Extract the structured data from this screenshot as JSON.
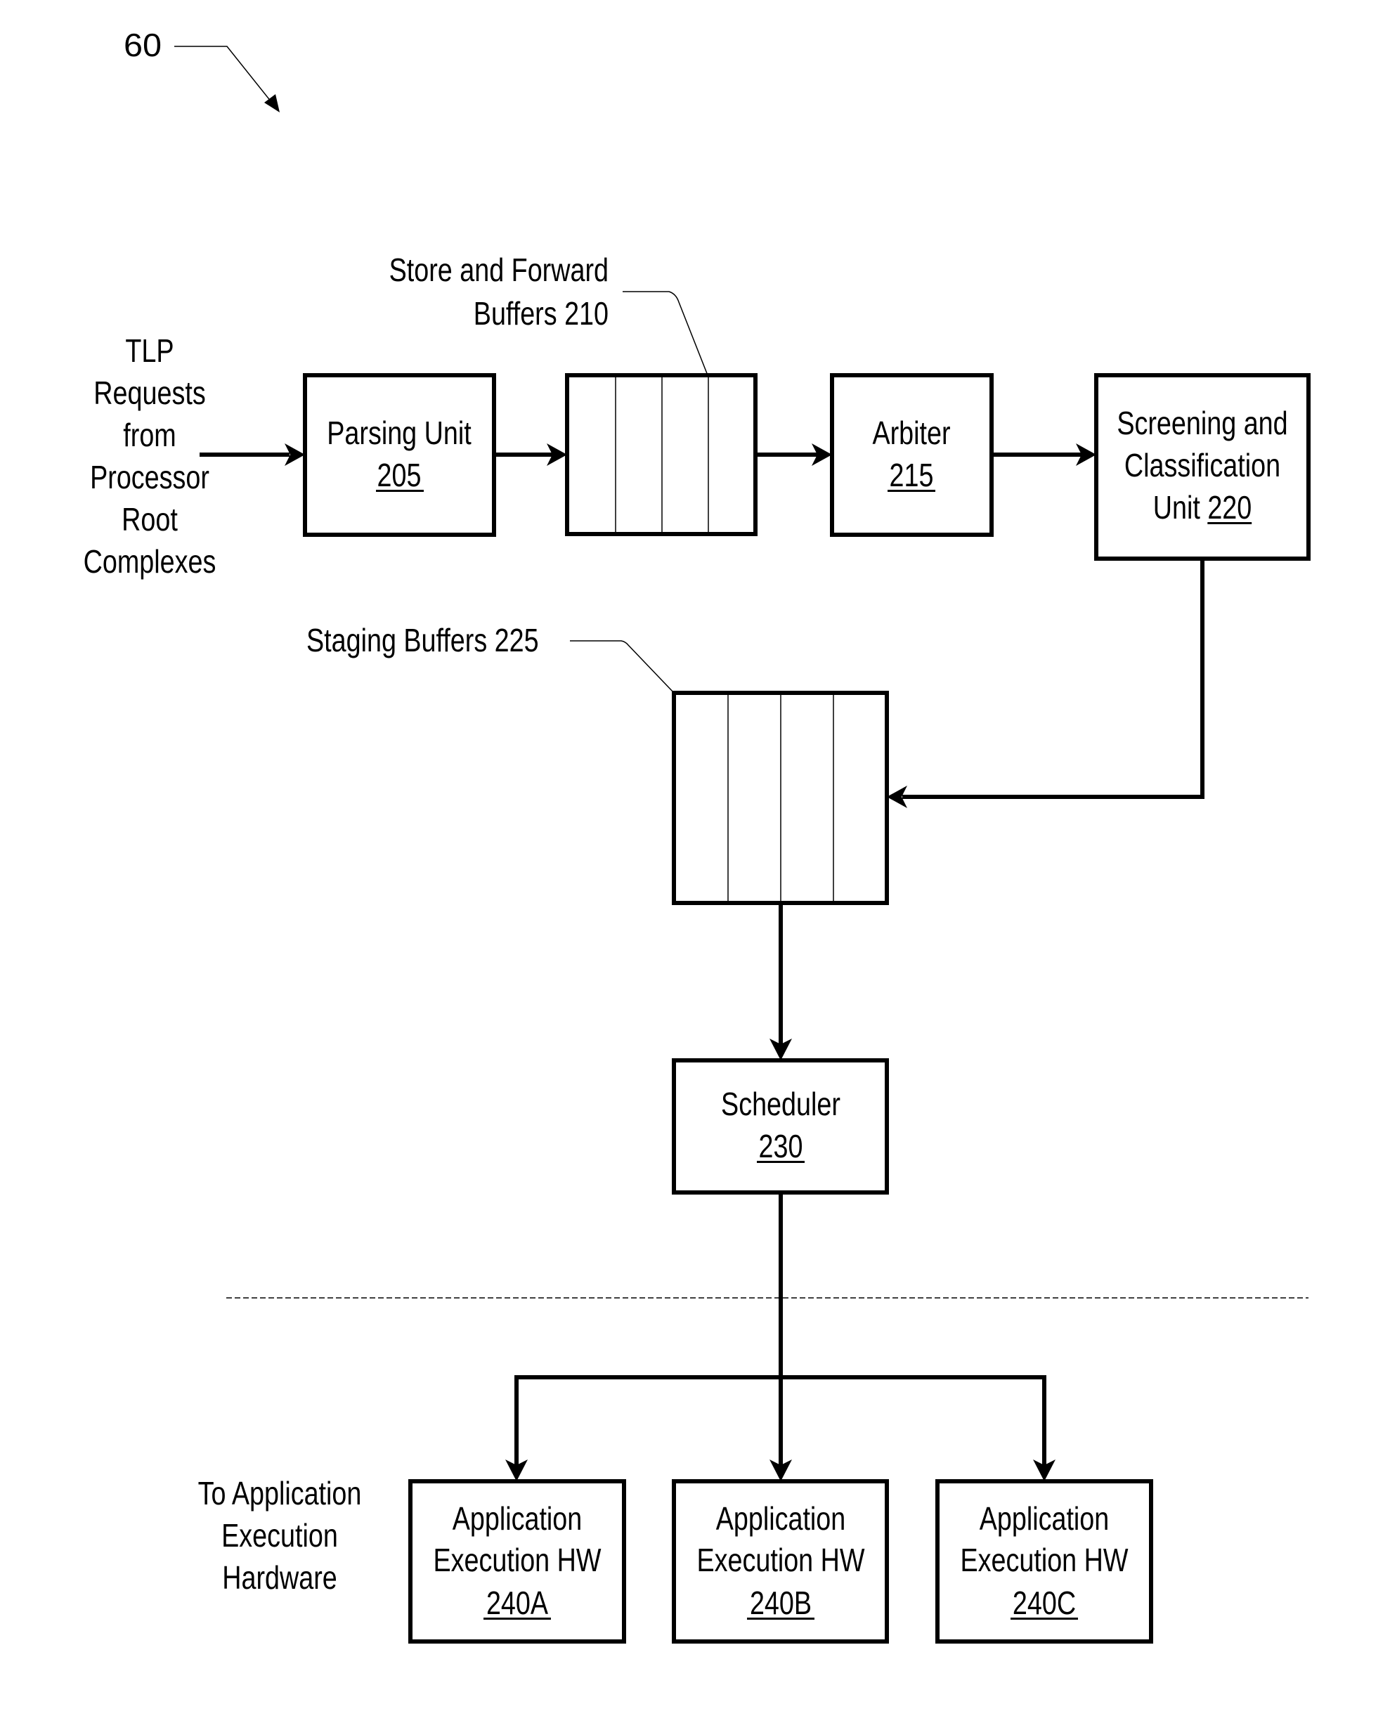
{
  "figure": {
    "reference_number": "60"
  },
  "inputs": {
    "source_label_lines": [
      "TLP",
      "Requests",
      "from",
      "Processor",
      "Root",
      "Complexes"
    ]
  },
  "blocks": {
    "parsing_unit": {
      "name_lines": [
        "Parsing Unit"
      ],
      "ref": "205"
    },
    "store_forward_buffers": {
      "label_lines": [
        "Store and Forward",
        "Buffers 210"
      ],
      "slots": 4
    },
    "arbiter": {
      "name_lines": [
        "Arbiter"
      ],
      "ref": "215"
    },
    "screening_unit": {
      "name_lines": [
        "Screening and",
        "Classification"
      ],
      "last_line_prefix": "Unit ",
      "ref": "220"
    },
    "staging_buffers": {
      "label": "Staging Buffers 225",
      "slots": 4
    },
    "scheduler": {
      "name_lines": [
        "Scheduler"
      ],
      "ref": "230"
    }
  },
  "outputs": {
    "destination_label_lines": [
      "To Application",
      "Execution",
      "Hardware"
    ],
    "hardware_units": [
      {
        "name_lines": [
          "Application",
          "Execution HW"
        ],
        "ref": "240A"
      },
      {
        "name_lines": [
          "Application",
          "Execution HW"
        ],
        "ref": "240B"
      },
      {
        "name_lines": [
          "Application",
          "Execution HW"
        ],
        "ref": "240C"
      }
    ]
  }
}
